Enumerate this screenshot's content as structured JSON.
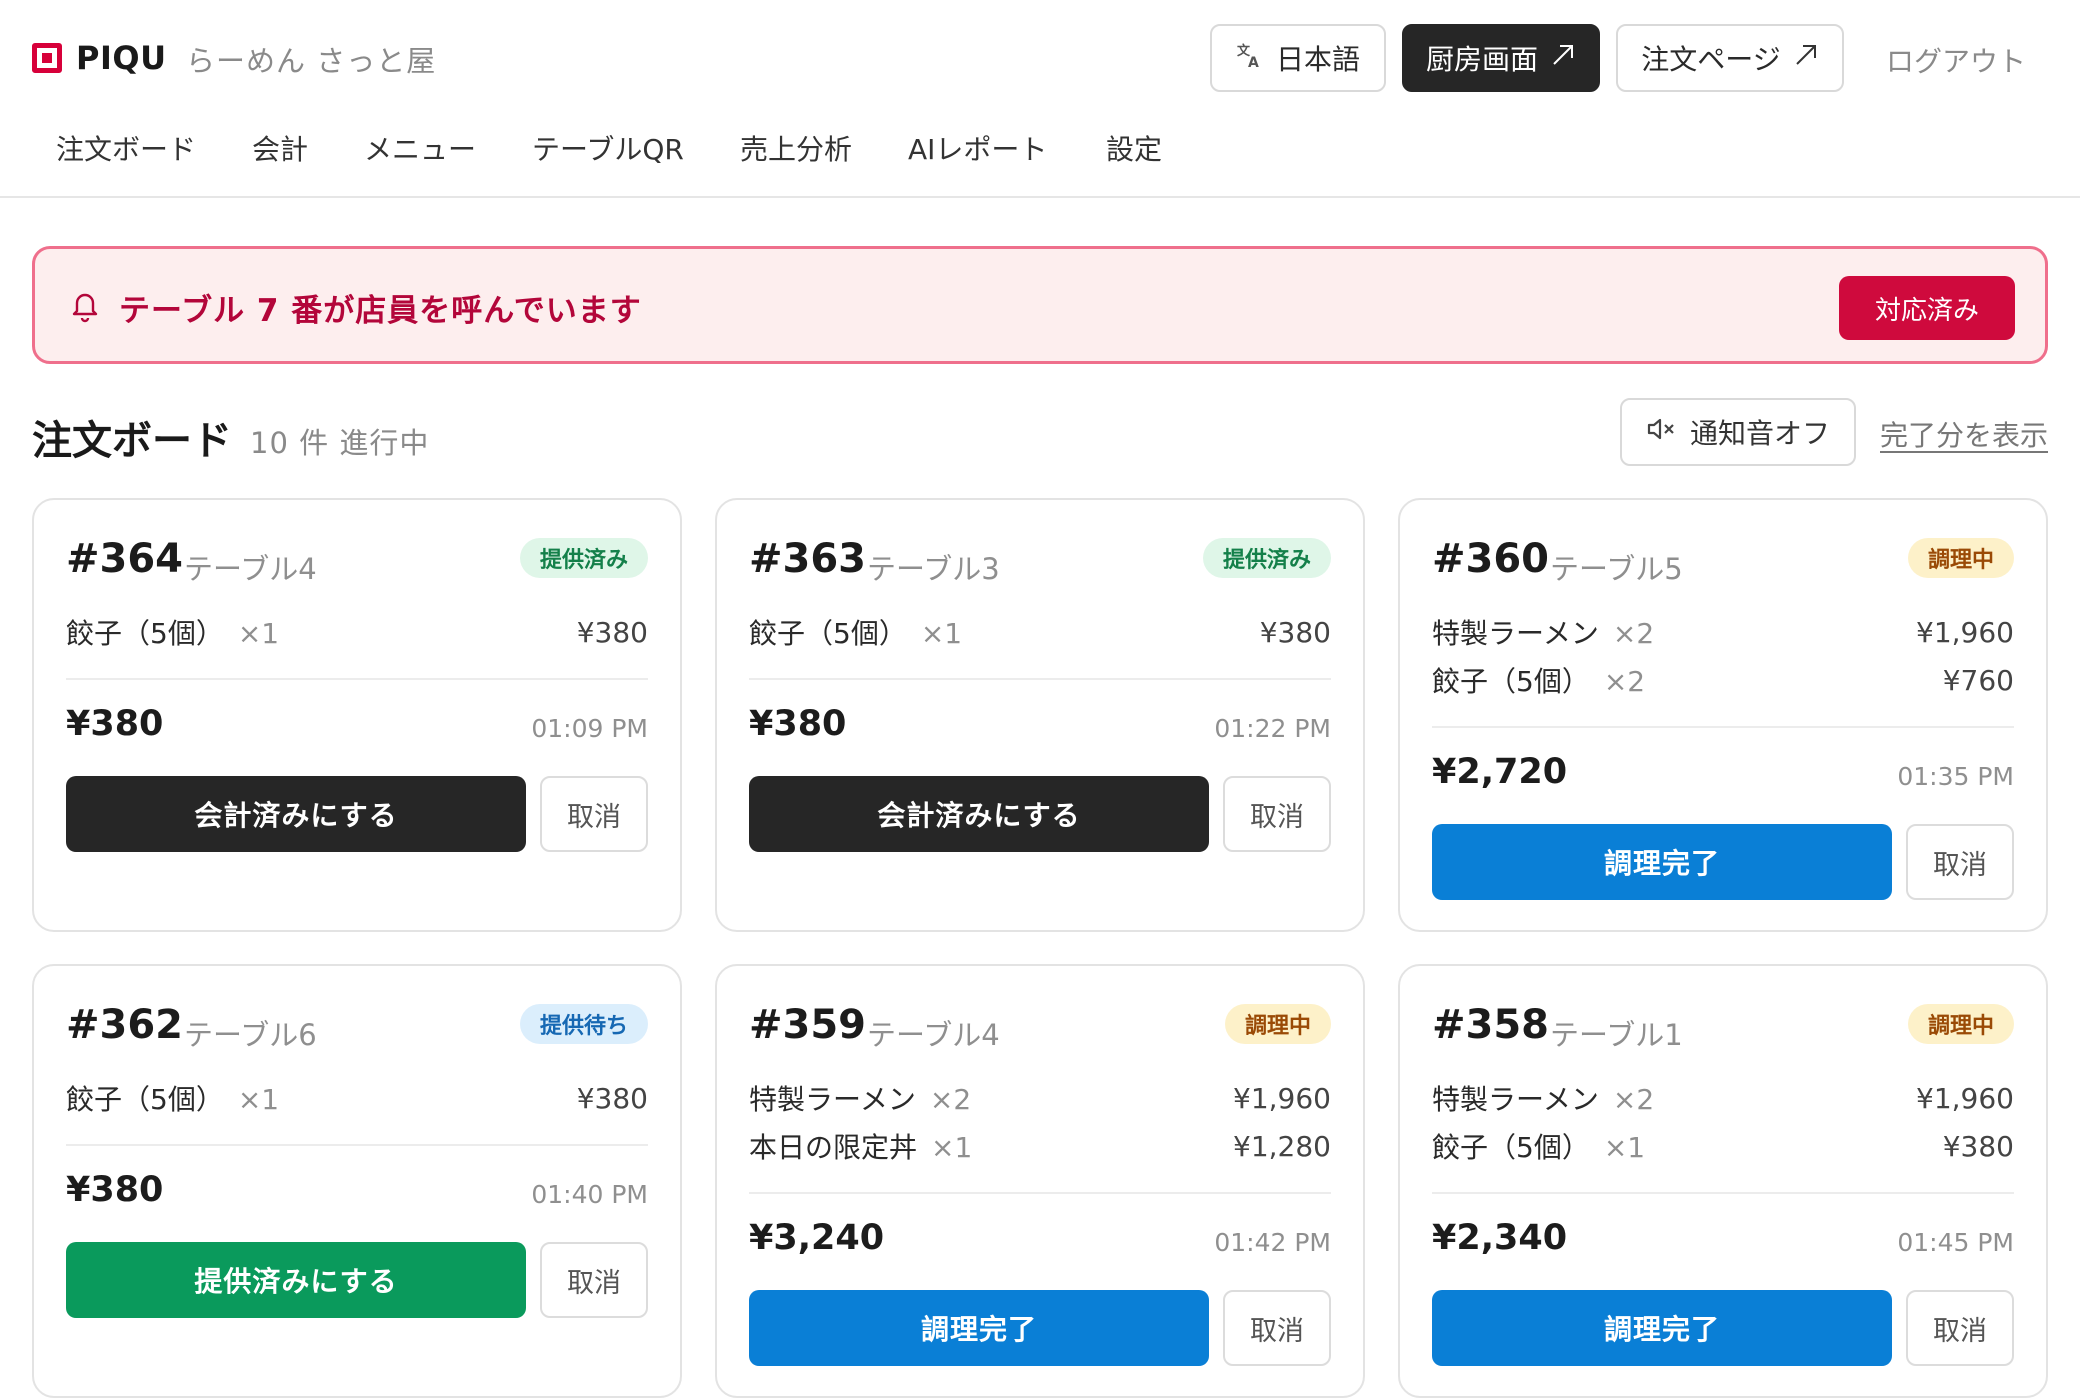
{
  "header": {
    "logo_text": "PIQU",
    "shop_name": "らーめん さっと屋",
    "lang_label": "日本語",
    "kitchen_label": "厨房画面",
    "order_page_label": "注文ページ",
    "logout_label": "ログアウト"
  },
  "nav": {
    "items": [
      "注文ボード",
      "会計",
      "メニュー",
      "テーブルQR",
      "売上分析",
      "AIレポート",
      "設定"
    ]
  },
  "alert": {
    "message": "テーブル 7 番が店員を呼んでいます",
    "button_label": "対応済み"
  },
  "board": {
    "title": "注文ボード",
    "count_text": "10 件 進行中",
    "mute_label": "通知音オフ",
    "show_done_label": "完了分を表示"
  },
  "colors": {
    "accent_red": "#cf0a3d",
    "blue_action": "#0a7fd6",
    "green_action": "#0a9a5c",
    "dark_action": "#262626"
  },
  "orders": [
    {
      "number": "#364",
      "table": "テーブル4",
      "status": "提供済み",
      "items": [
        {
          "name": "餃子（5個）",
          "qty": "×1",
          "price": "¥380"
        }
      ],
      "total": "¥380",
      "time": "01:09 PM",
      "action_label": "会計済みにする",
      "cancel_label": "取消"
    },
    {
      "number": "#363",
      "table": "テーブル3",
      "status": "提供済み",
      "items": [
        {
          "name": "餃子（5個）",
          "qty": "×1",
          "price": "¥380"
        }
      ],
      "total": "¥380",
      "time": "01:22 PM",
      "action_label": "会計済みにする",
      "cancel_label": "取消"
    },
    {
      "number": "#360",
      "table": "テーブル5",
      "status": "調理中",
      "items": [
        {
          "name": "特製ラーメン",
          "qty": "×2",
          "price": "¥1,960"
        },
        {
          "name": "餃子（5個）",
          "qty": "×2",
          "price": "¥760"
        }
      ],
      "total": "¥2,720",
      "time": "01:35 PM",
      "action_label": "調理完了",
      "cancel_label": "取消"
    },
    {
      "number": "#362",
      "table": "テーブル6",
      "status": "提供待ち",
      "items": [
        {
          "name": "餃子（5個）",
          "qty": "×1",
          "price": "¥380"
        }
      ],
      "total": "¥380",
      "time": "01:40 PM",
      "action_label": "提供済みにする",
      "cancel_label": "取消"
    },
    {
      "number": "#359",
      "table": "テーブル4",
      "status": "調理中",
      "items": [
        {
          "name": "特製ラーメン",
          "qty": "×2",
          "price": "¥1,960"
        },
        {
          "name": "本日の限定丼",
          "qty": "×1",
          "price": "¥1,280"
        }
      ],
      "total": "¥3,240",
      "time": "01:42 PM",
      "action_label": "調理完了",
      "cancel_label": "取消"
    },
    {
      "number": "#358",
      "table": "テーブル1",
      "status": "調理中",
      "items": [
        {
          "name": "特製ラーメン",
          "qty": "×2",
          "price": "¥1,960"
        },
        {
          "name": "餃子（5個）",
          "qty": "×1",
          "price": "¥380"
        }
      ],
      "total": "¥2,340",
      "time": "01:45 PM",
      "action_label": "調理完了",
      "cancel_label": "取消"
    }
  ]
}
